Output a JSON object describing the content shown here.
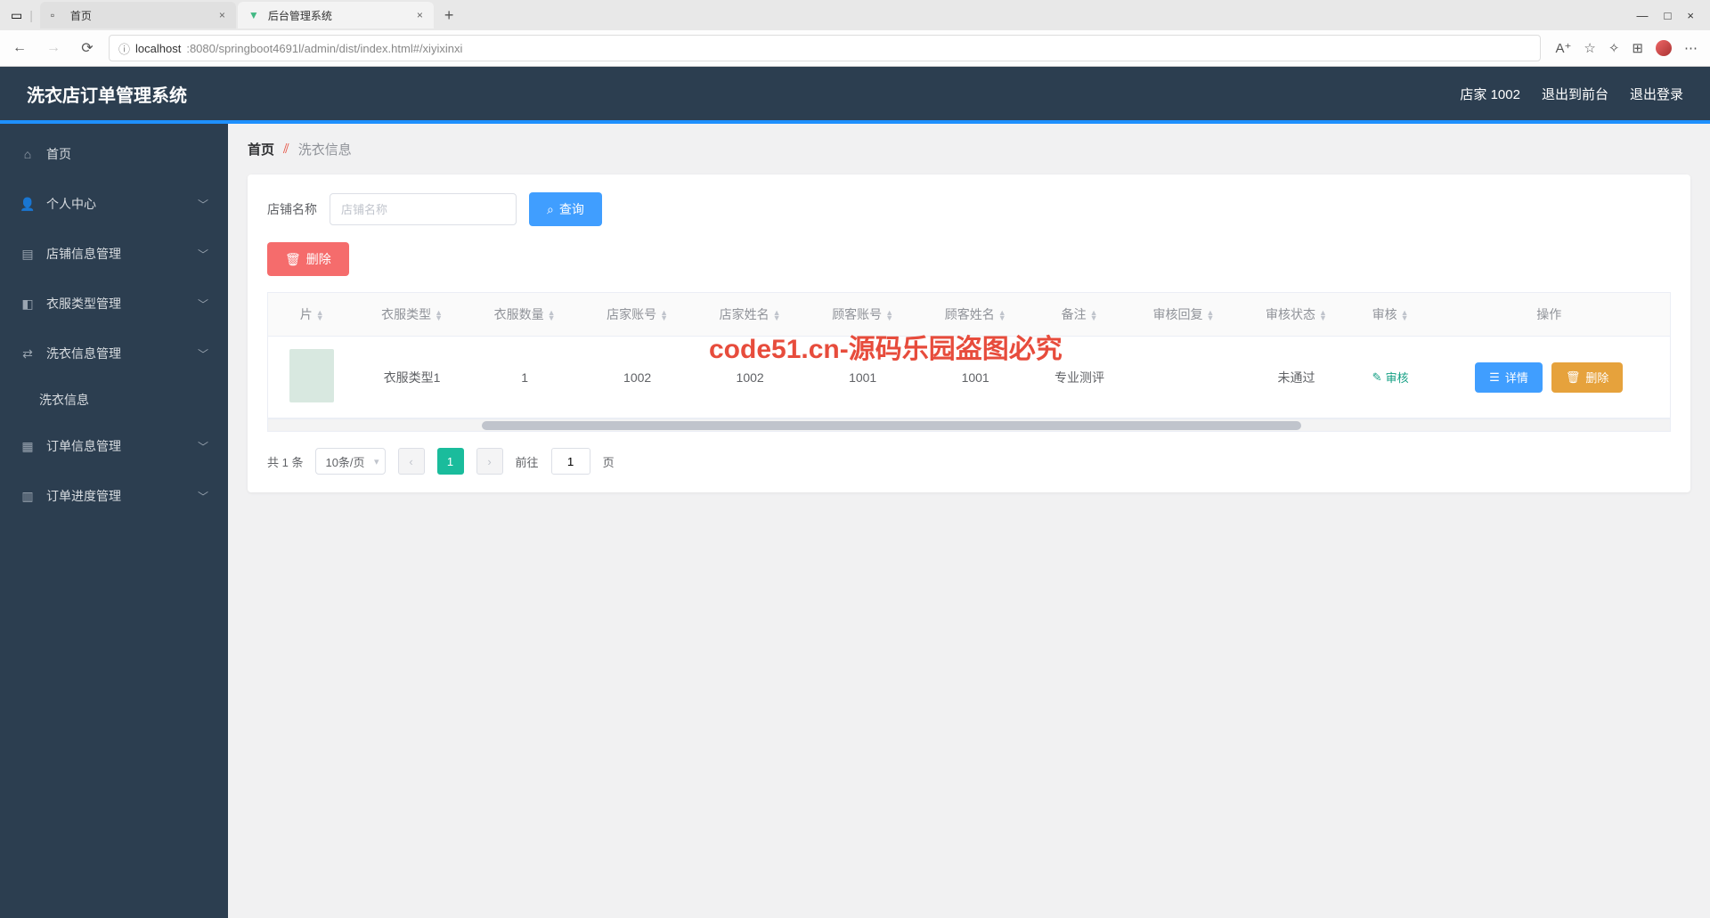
{
  "browser": {
    "tabs": [
      {
        "title": "首页"
      },
      {
        "title": "后台管理系统"
      }
    ],
    "url_host": "localhost",
    "url_path": ":8080/springboot4691l/admin/dist/index.html#/xiyixinxi"
  },
  "header": {
    "app_title": "洗衣店订单管理系统",
    "user_label": "店家 1002",
    "back_front": "退出到前台",
    "logout": "退出登录"
  },
  "sidebar": {
    "items": [
      {
        "label": "首页",
        "icon": "home",
        "type": "item"
      },
      {
        "label": "个人中心",
        "icon": "user",
        "type": "submenu"
      },
      {
        "label": "店铺信息管理",
        "icon": "shop",
        "type": "submenu"
      },
      {
        "label": "衣服类型管理",
        "icon": "tag",
        "type": "submenu"
      },
      {
        "label": "洗衣信息管理",
        "icon": "wash",
        "type": "submenu",
        "expanded": true
      },
      {
        "label": "洗衣信息",
        "type": "sub"
      },
      {
        "label": "订单信息管理",
        "icon": "order",
        "type": "submenu"
      },
      {
        "label": "订单进度管理",
        "icon": "progress",
        "type": "submenu"
      }
    ]
  },
  "breadcrumb": {
    "home": "首页",
    "current": "洗衣信息"
  },
  "search": {
    "label": "店铺名称",
    "placeholder": "店铺名称",
    "query_btn": "查询"
  },
  "toolbar": {
    "delete_btn": "删除"
  },
  "table": {
    "columns": [
      "片",
      "衣服类型",
      "衣服数量",
      "店家账号",
      "店家姓名",
      "顾客账号",
      "顾客姓名",
      "备注",
      "审核回复",
      "审核状态",
      "审核",
      "操作"
    ],
    "rows": [
      {
        "type": "衣服类型1",
        "qty": "1",
        "shop_acct": "1002",
        "shop_name": "1002",
        "cust_acct": "1001",
        "cust_name": "1001",
        "remark": "专业测评",
        "review_reply": "",
        "review_status": "未通过",
        "audit_link": "审核",
        "detail_btn": "详情",
        "delete_btn": "删除"
      }
    ]
  },
  "pagination": {
    "total_text": "共 1 条",
    "per_page": "10条/页",
    "current": "1",
    "goto_label": "前往",
    "goto_value": "1",
    "goto_suffix": "页"
  },
  "watermark": {
    "text": "code51.cn",
    "red_text": "code51.cn-源码乐园盗图必究"
  }
}
